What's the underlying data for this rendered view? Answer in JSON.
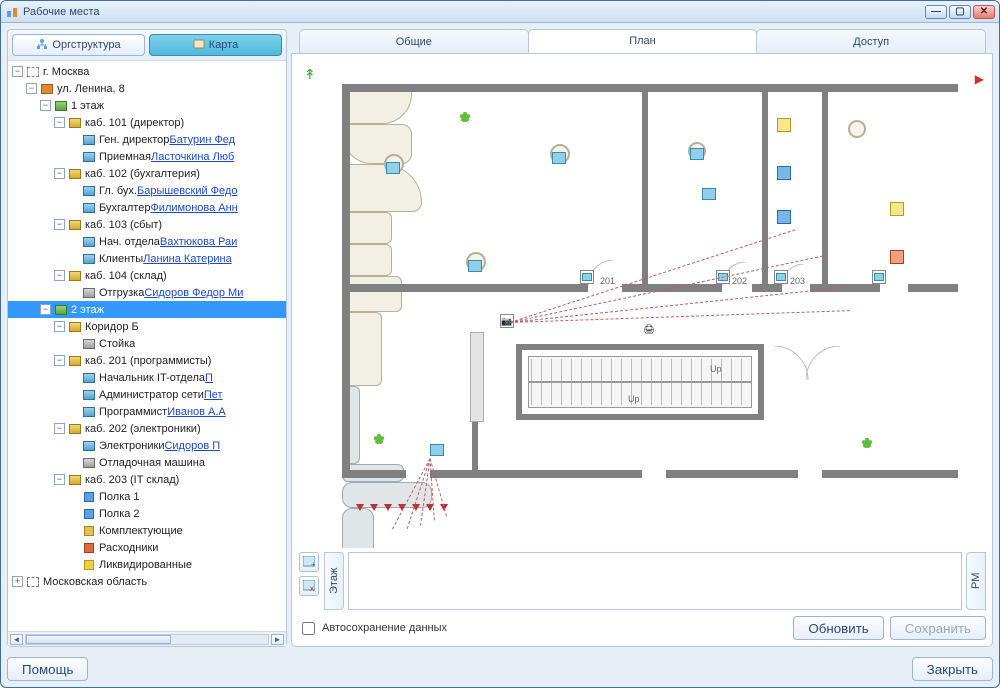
{
  "window": {
    "title": "Рабочие места"
  },
  "leftTabs": {
    "org": "Оргструктура",
    "map": "Карта"
  },
  "tree": [
    {
      "d": 0,
      "exp": "-",
      "ic": "city",
      "text": "г. Москва"
    },
    {
      "d": 1,
      "exp": "-",
      "ic": "bldg",
      "text": "ул. Ленина, 8"
    },
    {
      "d": 2,
      "exp": "-",
      "ic": "floor",
      "text": "1 этаж"
    },
    {
      "d": 3,
      "exp": "-",
      "ic": "room",
      "text": "каб. 101 (директор)"
    },
    {
      "d": 4,
      "exp": " ",
      "ic": "pc",
      "text": "Ген. директор ",
      "link": "Батурин Фед"
    },
    {
      "d": 4,
      "exp": " ",
      "ic": "pc",
      "text": "Приемная ",
      "link": "Ласточкина Люб"
    },
    {
      "d": 3,
      "exp": "-",
      "ic": "room",
      "text": "каб. 102 (бухгалтерия)"
    },
    {
      "d": 4,
      "exp": " ",
      "ic": "pc",
      "text": "Гл. бух. ",
      "link": "Барышевский Федо"
    },
    {
      "d": 4,
      "exp": " ",
      "ic": "pc",
      "text": "Бухгалтер ",
      "link": "Филимонова Анн"
    },
    {
      "d": 3,
      "exp": "-",
      "ic": "room",
      "text": "каб. 103 (сбыт)"
    },
    {
      "d": 4,
      "exp": " ",
      "ic": "pc",
      "text": "Нач. отдела ",
      "link": "Вахтюкова Раи"
    },
    {
      "d": 4,
      "exp": " ",
      "ic": "pc",
      "text": "Клиенты ",
      "link": "Ланина Катерина"
    },
    {
      "d": 3,
      "exp": "-",
      "ic": "room",
      "text": "каб. 104 (склад)"
    },
    {
      "d": 4,
      "exp": " ",
      "ic": "server",
      "text": "Отгрузка ",
      "link": "Сидоров Федор Ми"
    },
    {
      "d": 2,
      "exp": "-",
      "ic": "floor",
      "text": "2 этаж",
      "sel": true
    },
    {
      "d": 3,
      "exp": "-",
      "ic": "room",
      "text": "Коридор Б"
    },
    {
      "d": 4,
      "exp": " ",
      "ic": "server",
      "text": "Стойка"
    },
    {
      "d": 3,
      "exp": "-",
      "ic": "room",
      "text": "каб. 201 (программисты)"
    },
    {
      "d": 4,
      "exp": " ",
      "ic": "pc",
      "text": "Начальник IT-отдела ",
      "link": "П"
    },
    {
      "d": 4,
      "exp": " ",
      "ic": "pc",
      "text": "Администратор сети ",
      "link": "Пет"
    },
    {
      "d": 4,
      "exp": " ",
      "ic": "pc",
      "text": "Программист ",
      "link": "Иванов А.А"
    },
    {
      "d": 3,
      "exp": "-",
      "ic": "room",
      "text": "каб. 202 (электроники)"
    },
    {
      "d": 4,
      "exp": " ",
      "ic": "pc",
      "text": "Электроники ",
      "link": "Сидоров П"
    },
    {
      "d": 4,
      "exp": " ",
      "ic": "server",
      "text": "Отладочная машина"
    },
    {
      "d": 3,
      "exp": "-",
      "ic": "room",
      "text": "каб. 203 (IT склад)"
    },
    {
      "d": 4,
      "exp": " ",
      "ic": "shelf",
      "text": "Полка 1"
    },
    {
      "d": 4,
      "exp": " ",
      "ic": "shelf",
      "text": "Полка 2"
    },
    {
      "d": 4,
      "exp": " ",
      "ic": "box",
      "text": "Комплектующие"
    },
    {
      "d": 4,
      "exp": " ",
      "ic": "red",
      "text": "Расходники"
    },
    {
      "d": 4,
      "exp": " ",
      "ic": "yellow",
      "text": "Ликвидированные"
    },
    {
      "d": 0,
      "exp": "+",
      "ic": "region",
      "text": "Московская область"
    }
  ],
  "tabs": {
    "common": "Общие",
    "plan": "План",
    "access": "Доступ"
  },
  "plan": {
    "rooms": {
      "r201": "201",
      "r202": "202",
      "r203": "203"
    },
    "stairs": {
      "up": "Up"
    }
  },
  "vert": {
    "floor": "Этаж",
    "rm": "РМ"
  },
  "checkbox": "Автосохранение данных",
  "buttons": {
    "refresh": "Обновить",
    "save": "Сохранить",
    "help": "Помощь",
    "close": "Закрыть"
  }
}
